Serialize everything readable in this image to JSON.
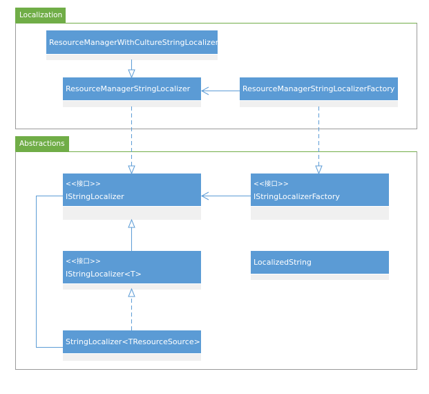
{
  "packages": [
    {
      "name": "Localization"
    },
    {
      "name": "Abstractions"
    }
  ],
  "classes": {
    "rmwc": {
      "name": "ResourceManagerWithCultureStringLocalizer",
      "stereotype": ""
    },
    "rms": {
      "name": "ResourceManagerStringLocalizer",
      "stereotype": ""
    },
    "rmsf": {
      "name": "ResourceManagerStringLocalizerFactory",
      "stereotype": ""
    },
    "isl": {
      "name": "IStringLocalizer",
      "stereotype": "<<接口>>"
    },
    "islf": {
      "name": "IStringLocalizerFactory",
      "stereotype": "<<接口>>"
    },
    "islt": {
      "name": "IStringLocalizer<T>",
      "stereotype": "<<接口>>"
    },
    "ls": {
      "name": "LocalizedString",
      "stereotype": ""
    },
    "sl": {
      "name": "StringLocalizer<TResourceSource>",
      "stereotype": ""
    }
  },
  "colors": {
    "class_fill": "#5b9bd5",
    "package_tab": "#70ad47",
    "connector": "#5b9bd5"
  }
}
